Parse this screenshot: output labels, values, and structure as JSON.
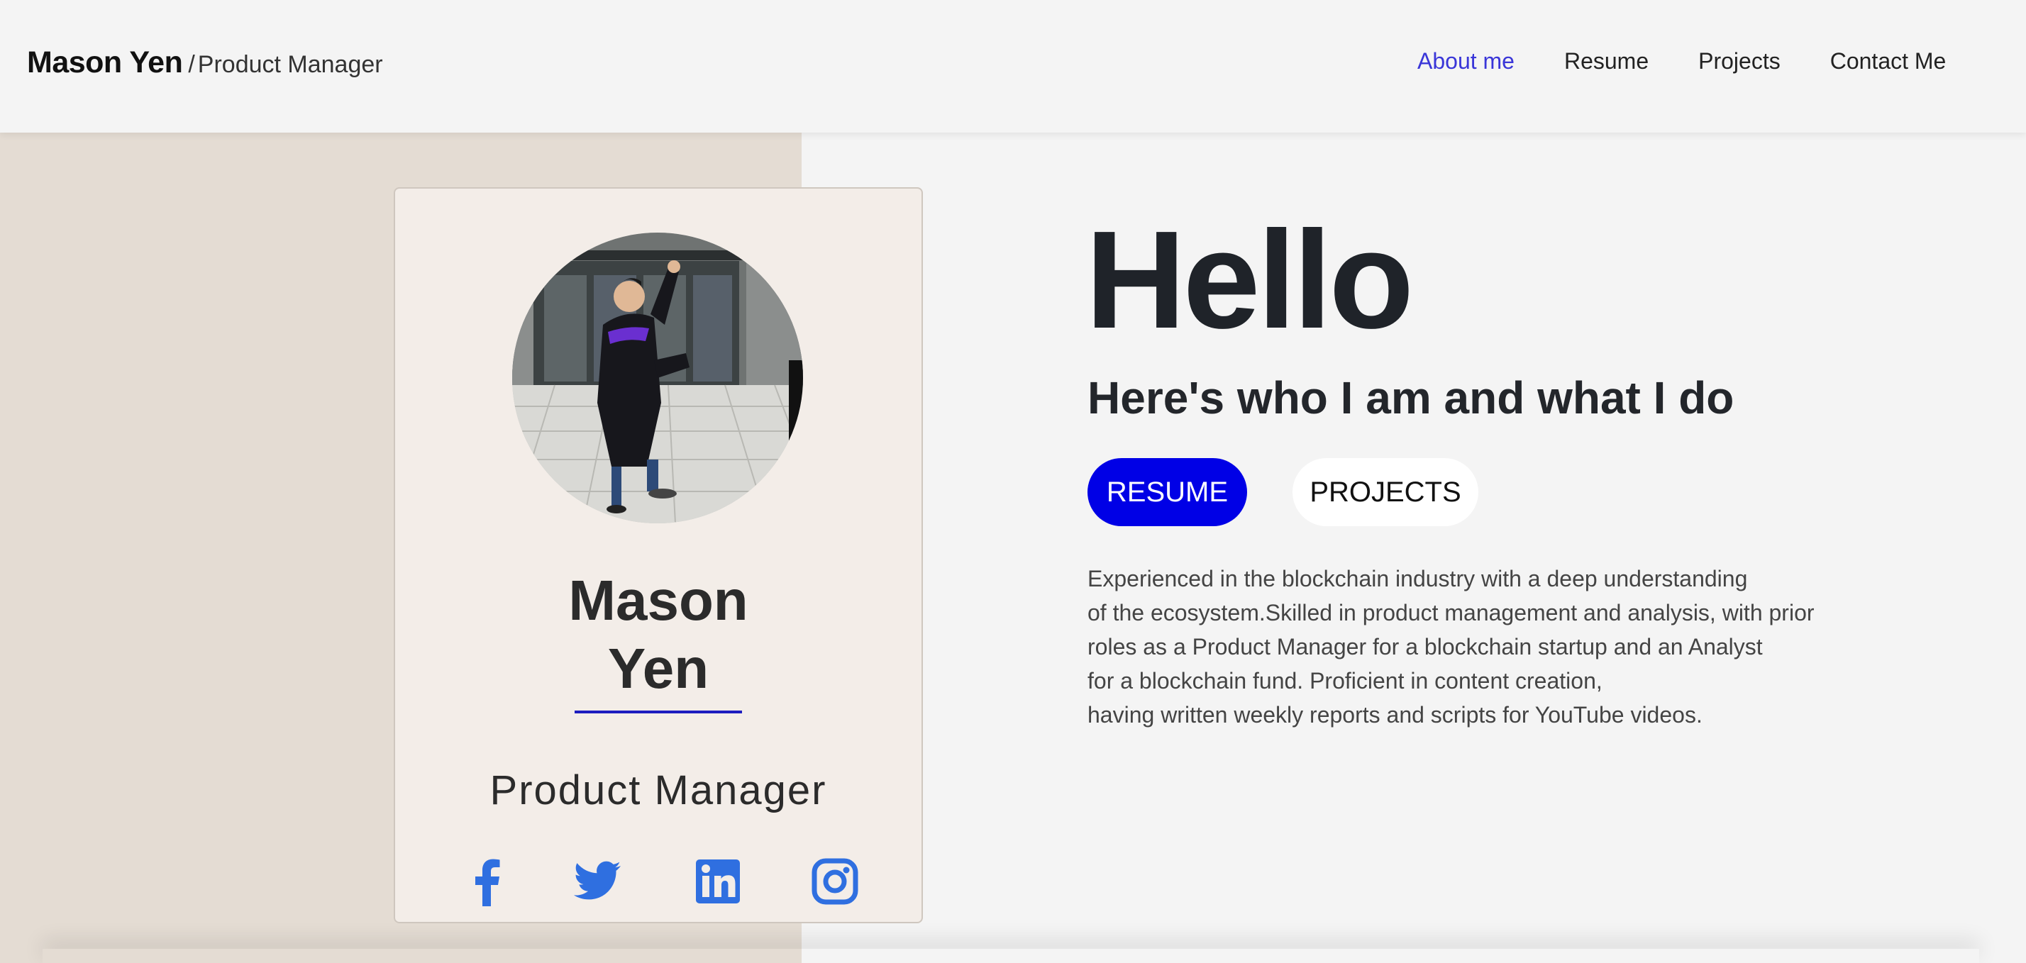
{
  "header": {
    "brand_name": "Mason Yen",
    "brand_separator": "/",
    "brand_role": "Product Manager",
    "nav": [
      {
        "label": "About me",
        "active": true
      },
      {
        "label": "Resume",
        "active": false
      },
      {
        "label": "Projects",
        "active": false
      },
      {
        "label": "Contact Me",
        "active": false
      }
    ]
  },
  "profile_card": {
    "avatar_alt": "",
    "name_line1": "Mason",
    "name_line2": "Yen",
    "role": "Product Manager",
    "socials": [
      {
        "icon": "facebook-icon"
      },
      {
        "icon": "twitter-icon"
      },
      {
        "icon": "linkedin-icon"
      },
      {
        "icon": "instagram-icon"
      }
    ]
  },
  "main": {
    "heading": "Hello",
    "subheading": "Here's who I am and what I do",
    "buttons": {
      "resume": "RESUME",
      "projects": "PROJECTS"
    },
    "about_lines": [
      "Experienced in the blockchain industry with a deep understanding",
      "of the ecosystem.Skilled in product management and analysis, with prior",
      "roles as a Product Manager for a blockchain startup and an Analyst",
      "for a blockchain fund. Proficient in content creation,",
      "having written weekly reports and scripts for YouTube videos."
    ]
  },
  "colors": {
    "accent": "#3a36d8",
    "primary_button": "#0000e6",
    "social_icon": "#2f6fe0",
    "left_panel": "#e4dcd3",
    "card": "#f3ede8"
  }
}
